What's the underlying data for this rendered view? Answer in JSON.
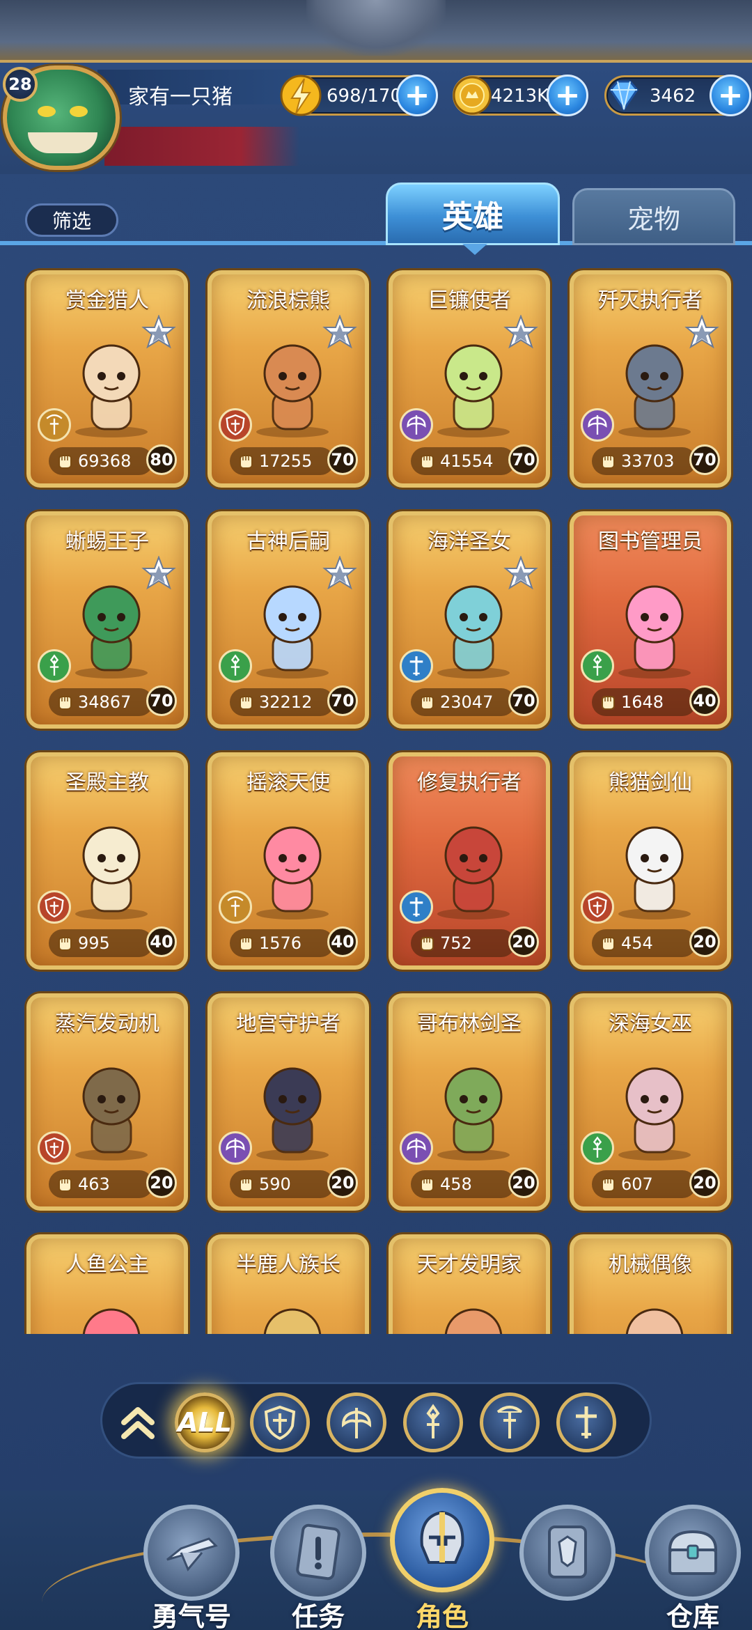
{
  "player": {
    "level": "28",
    "name": "家有一只猪"
  },
  "resources": {
    "energy": "698/170",
    "gold": "4213K",
    "gems": "3462"
  },
  "filter_label": "筛选",
  "tabs": {
    "heroes": "英雄",
    "pets": "宠物"
  },
  "heroes": [
    {
      "name": "赏金猎人",
      "power": "69368",
      "level": "80",
      "star": true,
      "cls": "bow",
      "bg": "gold"
    },
    {
      "name": "流浪棕熊",
      "power": "17255",
      "level": "70",
      "star": true,
      "cls": "shield",
      "bg": "gold"
    },
    {
      "name": "巨镰使者",
      "power": "41554",
      "level": "70",
      "star": true,
      "cls": "axe",
      "bg": "gold"
    },
    {
      "name": "歼灭执行者",
      "power": "33703",
      "level": "70",
      "star": true,
      "cls": "axe",
      "bg": "gold"
    },
    {
      "name": "蜥蜴王子",
      "power": "34867",
      "level": "70",
      "star": true,
      "cls": "staff",
      "bg": "gold"
    },
    {
      "name": "古神后嗣",
      "power": "32212",
      "level": "70",
      "star": true,
      "cls": "staff",
      "bg": "gold"
    },
    {
      "name": "海洋圣女",
      "power": "23047",
      "level": "70",
      "star": true,
      "cls": "cross",
      "bg": "gold"
    },
    {
      "name": "图书管理员",
      "power": "1648",
      "level": "40",
      "star": false,
      "cls": "staff",
      "bg": "red"
    },
    {
      "name": "圣殿主教",
      "power": "995",
      "level": "40",
      "star": false,
      "cls": "shield",
      "bg": "gold"
    },
    {
      "name": "摇滚天使",
      "power": "1576",
      "level": "40",
      "star": false,
      "cls": "bow",
      "bg": "gold"
    },
    {
      "name": "修复执行者",
      "power": "752",
      "level": "20",
      "star": false,
      "cls": "cross",
      "bg": "red"
    },
    {
      "name": "熊猫剑仙",
      "power": "454",
      "level": "20",
      "star": false,
      "cls": "shield",
      "bg": "gold"
    },
    {
      "name": "蒸汽发动机",
      "power": "463",
      "level": "20",
      "star": false,
      "cls": "shield",
      "bg": "gold"
    },
    {
      "name": "地宫守护者",
      "power": "590",
      "level": "20",
      "star": false,
      "cls": "axe",
      "bg": "gold"
    },
    {
      "name": "哥布林剑圣",
      "power": "458",
      "level": "20",
      "star": false,
      "cls": "axe",
      "bg": "gold"
    },
    {
      "name": "深海女巫",
      "power": "607",
      "level": "20",
      "star": false,
      "cls": "staff",
      "bg": "gold"
    },
    {
      "name": "人鱼公主",
      "power": "",
      "level": "",
      "star": false,
      "cls": "",
      "bg": "gold"
    },
    {
      "name": "半鹿人族长",
      "power": "",
      "level": "",
      "star": false,
      "cls": "",
      "bg": "gold"
    },
    {
      "name": "天才发明家",
      "power": "",
      "level": "",
      "star": false,
      "cls": "",
      "bg": "gold"
    },
    {
      "name": "机械偶像",
      "power": "",
      "level": "",
      "star": false,
      "cls": "",
      "bg": "gold"
    }
  ],
  "class_filters": {
    "all_label": "ALL",
    "icons": [
      "shield-icon",
      "axe-icon",
      "staff-icon",
      "bow-icon",
      "cross-sword-icon"
    ]
  },
  "nav": {
    "brave": "勇气号",
    "tasks": "任务",
    "heroes": "角色",
    "warehouse": "仓库"
  },
  "colors": {
    "accent_blue": "#5ba6e6",
    "card_gold": "#e8a647",
    "card_red": "#e06a3f",
    "frame_gold": "#d8b462"
  }
}
